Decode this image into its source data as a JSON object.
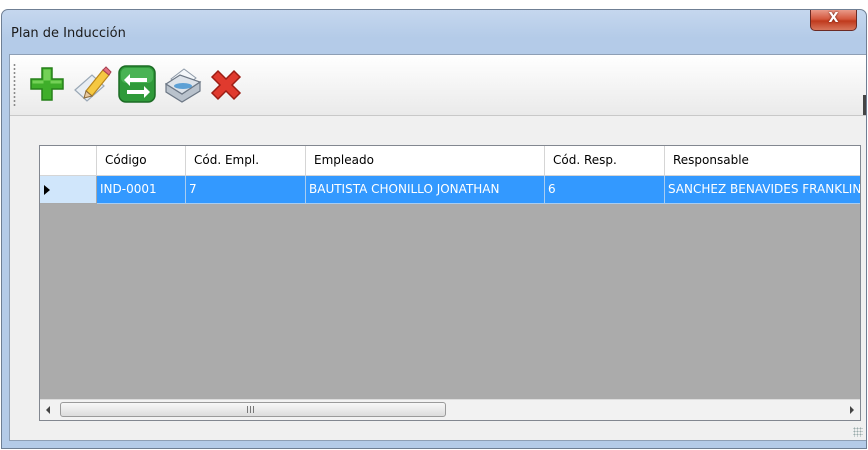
{
  "window": {
    "title": "Plan de Inducción",
    "close_label": "X"
  },
  "toolbar": {
    "buttons": [
      {
        "icon": "add-icon"
      },
      {
        "icon": "edit-icon"
      },
      {
        "icon": "transfer-icon"
      },
      {
        "icon": "print-icon"
      },
      {
        "icon": "delete-icon"
      }
    ]
  },
  "grid": {
    "columns": [
      "Código",
      "Cód. Empl.",
      "Empleado",
      "Cód. Resp.",
      "Responsable"
    ],
    "rows": [
      {
        "codigo": "IND-0001",
        "cod_empl": "7",
        "empleado": "BAUTISTA CHONILLO JONATHAN",
        "cod_resp": "6",
        "responsable": "SANCHEZ BENAVIDES FRANKLIN"
      }
    ],
    "selection_color": "#3399ff",
    "scrollbar": {
      "thumb_glyph": "III"
    }
  }
}
